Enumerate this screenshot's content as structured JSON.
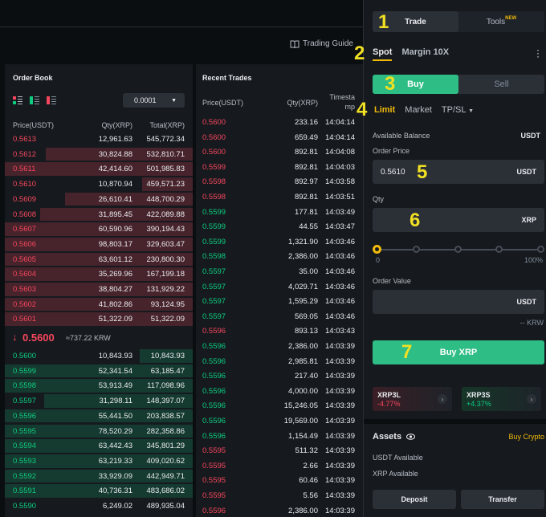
{
  "header": {
    "trading_guide": "Trading Guide"
  },
  "order_book": {
    "title": "Order Book",
    "precision": "0.0001",
    "col_price": "Price(USDT)",
    "col_qty": "Qty(XRP)",
    "col_total": "Total(XRP)",
    "asks": [
      {
        "price": "0.5613",
        "qty": "12,961.63",
        "total": "545,772.34",
        "depth": 0.0
      },
      {
        "price": "0.5612",
        "qty": "30,824.88",
        "total": "532,810.71",
        "depth": 0.78
      },
      {
        "price": "0.5611",
        "qty": "42,414.60",
        "total": "501,985.83",
        "depth": 1.0
      },
      {
        "price": "0.5610",
        "qty": "10,870.94",
        "total": "459,571.23",
        "depth": 0.27
      },
      {
        "price": "0.5609",
        "qty": "26,610.41",
        "total": "448,700.29",
        "depth": 0.68
      },
      {
        "price": "0.5608",
        "qty": "31,895.45",
        "total": "422,089.88",
        "depth": 0.81
      },
      {
        "price": "0.5607",
        "qty": "60,590.96",
        "total": "390,194.43",
        "depth": 1.0
      },
      {
        "price": "0.5606",
        "qty": "98,803.17",
        "total": "329,603.47",
        "depth": 1.0
      },
      {
        "price": "0.5605",
        "qty": "63,601.12",
        "total": "230,800.30",
        "depth": 1.0
      },
      {
        "price": "0.5604",
        "qty": "35,269.96",
        "total": "167,199.18",
        "depth": 1.0
      },
      {
        "price": "0.5603",
        "qty": "38,804.27",
        "total": "131,929.22",
        "depth": 1.0
      },
      {
        "price": "0.5602",
        "qty": "41,802.86",
        "total": "93,124.95",
        "depth": 1.0
      },
      {
        "price": "0.5601",
        "qty": "51,322.09",
        "total": "51,322.09",
        "depth": 1.0
      }
    ],
    "last_price": "0.5600",
    "last_price_fiat": "≈737.22 KRW",
    "bids": [
      {
        "price": "0.5600",
        "qty": "10,843.93",
        "total": "10,843.93",
        "depth": 0.28
      },
      {
        "price": "0.5599",
        "qty": "52,341.54",
        "total": "63,185.47",
        "depth": 1.0
      },
      {
        "price": "0.5598",
        "qty": "53,913.49",
        "total": "117,098.96",
        "depth": 1.0
      },
      {
        "price": "0.5597",
        "qty": "31,298.11",
        "total": "148,397.07",
        "depth": 0.79
      },
      {
        "price": "0.5596",
        "qty": "55,441.50",
        "total": "203,838.57",
        "depth": 1.0
      },
      {
        "price": "0.5595",
        "qty": "78,520.29",
        "total": "282,358.86",
        "depth": 1.0
      },
      {
        "price": "0.5594",
        "qty": "63,442.43",
        "total": "345,801.29",
        "depth": 1.0
      },
      {
        "price": "0.5593",
        "qty": "63,219.33",
        "total": "409,020.62",
        "depth": 1.0
      },
      {
        "price": "0.5592",
        "qty": "33,929.09",
        "total": "442,949.71",
        "depth": 1.0
      },
      {
        "price": "0.5591",
        "qty": "40,736.31",
        "total": "483,686.02",
        "depth": 1.0
      },
      {
        "price": "0.5590",
        "qty": "6,249.02",
        "total": "489,935.04",
        "depth": 0.0
      }
    ]
  },
  "recent_trades": {
    "title": "Recent Trades",
    "col_price": "Price(USDT)",
    "col_qty": "Qty(XRP)",
    "col_time_1": "Timesta",
    "col_time_2": "mp",
    "rows": [
      {
        "price": "0.5600",
        "qty": "233.16",
        "time": "14:04:14",
        "side": "sell"
      },
      {
        "price": "0.5600",
        "qty": "659.49",
        "time": "14:04:14",
        "side": "sell"
      },
      {
        "price": "0.5600",
        "qty": "892.81",
        "time": "14:04:08",
        "side": "sell"
      },
      {
        "price": "0.5599",
        "qty": "892.81",
        "time": "14:04:03",
        "side": "sell"
      },
      {
        "price": "0.5598",
        "qty": "892.97",
        "time": "14:03:58",
        "side": "sell"
      },
      {
        "price": "0.5598",
        "qty": "892.81",
        "time": "14:03:51",
        "side": "sell"
      },
      {
        "price": "0.5599",
        "qty": "177.81",
        "time": "14:03:49",
        "side": "buy"
      },
      {
        "price": "0.5599",
        "qty": "44.55",
        "time": "14:03:47",
        "side": "buy"
      },
      {
        "price": "0.5599",
        "qty": "1,321.90",
        "time": "14:03:46",
        "side": "buy"
      },
      {
        "price": "0.5598",
        "qty": "2,386.00",
        "time": "14:03:46",
        "side": "buy"
      },
      {
        "price": "0.5597",
        "qty": "35.00",
        "time": "14:03:46",
        "side": "buy"
      },
      {
        "price": "0.5597",
        "qty": "4,029.71",
        "time": "14:03:46",
        "side": "buy"
      },
      {
        "price": "0.5597",
        "qty": "1,595.29",
        "time": "14:03:46",
        "side": "buy"
      },
      {
        "price": "0.5597",
        "qty": "569.05",
        "time": "14:03:46",
        "side": "buy"
      },
      {
        "price": "0.5596",
        "qty": "893.13",
        "time": "14:03:43",
        "side": "sell"
      },
      {
        "price": "0.5596",
        "qty": "2,386.00",
        "time": "14:03:39",
        "side": "buy"
      },
      {
        "price": "0.5596",
        "qty": "2,985.81",
        "time": "14:03:39",
        "side": "buy"
      },
      {
        "price": "0.5596",
        "qty": "217.40",
        "time": "14:03:39",
        "side": "buy"
      },
      {
        "price": "0.5596",
        "qty": "4,000.00",
        "time": "14:03:39",
        "side": "buy"
      },
      {
        "price": "0.5596",
        "qty": "15,246.05",
        "time": "14:03:39",
        "side": "buy"
      },
      {
        "price": "0.5596",
        "qty": "19,569.00",
        "time": "14:03:39",
        "side": "buy"
      },
      {
        "price": "0.5596",
        "qty": "1,154.49",
        "time": "14:03:39",
        "side": "buy"
      },
      {
        "price": "0.5595",
        "qty": "511.32",
        "time": "14:03:39",
        "side": "sell"
      },
      {
        "price": "0.5595",
        "qty": "2.66",
        "time": "14:03:39",
        "side": "sell"
      },
      {
        "price": "0.5595",
        "qty": "60.46",
        "time": "14:03:39",
        "side": "sell"
      },
      {
        "price": "0.5595",
        "qty": "5.56",
        "time": "14:03:39",
        "side": "sell"
      },
      {
        "price": "0.5596",
        "qty": "2,386.00",
        "time": "14:03:39",
        "side": "sell"
      }
    ]
  },
  "order_panel": {
    "tab_trade": "Trade",
    "tab_tools": "Tools",
    "tab_tools_badge": "NEW",
    "spot": "Spot",
    "margin": "Margin 10X",
    "buy": "Buy",
    "sell": "Sell",
    "type_limit": "Limit",
    "type_market": "Market",
    "type_tpsl": "TP/SL",
    "available_balance_label": "Available Balance",
    "available_balance_unit": "USDT",
    "order_price_label": "Order Price",
    "order_price_value": "0.5610",
    "order_price_unit": "USDT",
    "qty_label": "Qty",
    "qty_unit": "XRP",
    "slider_min": "0",
    "slider_max": "100%",
    "slider_value": 0,
    "order_value_label": "Order Value",
    "order_value_unit": "USDT",
    "fiat_value": "-- KRW",
    "submit": "Buy XRP",
    "leveraged": [
      {
        "name": "XRP3L",
        "change": "-4.77%",
        "color": "#f6465d"
      },
      {
        "name": "XRP3S",
        "change": "+4.37%",
        "color": "#0ecb81"
      }
    ],
    "assets_title": "Assets",
    "buy_crypto": "Buy Crypto",
    "usdt_available": "USDT Available",
    "xrp_available": "XRP Available",
    "deposit": "Deposit",
    "transfer": "Transfer"
  },
  "annotations": [
    "1",
    "2",
    "3",
    "4",
    "5",
    "6",
    "7"
  ],
  "colors": {
    "buy": "#2ebd85",
    "sell": "#f6465d",
    "accent": "#f0b90b",
    "bg": "#0b0e11",
    "panel": "#161a1e"
  }
}
